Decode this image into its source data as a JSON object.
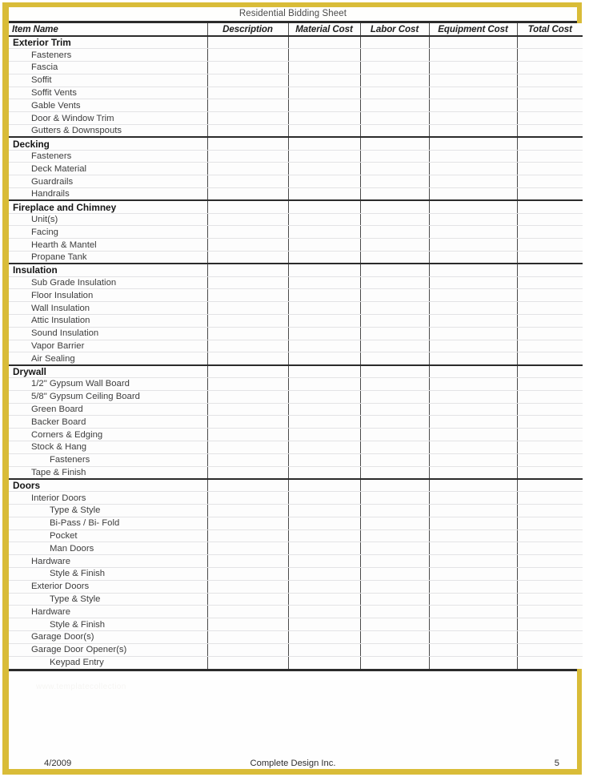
{
  "document": {
    "title": "Residential Bidding Sheet",
    "watermark": "www.templatecollection"
  },
  "colors": {
    "border_gold": "#d9bc38",
    "rule_dark": "#2b2b2b",
    "grid_light": "#e3e3e5",
    "text": "#3d3d3d"
  },
  "table": {
    "columns": [
      {
        "key": "item",
        "label": "Item Name",
        "align": "left"
      },
      {
        "key": "desc",
        "label": "Description",
        "align": "center"
      },
      {
        "key": "material",
        "label": "Material Cost",
        "align": "center"
      },
      {
        "key": "labor",
        "label": "Labor Cost",
        "align": "center"
      },
      {
        "key": "equipment",
        "label": "Equipment Cost",
        "align": "center"
      },
      {
        "key": "total",
        "label": "Total Cost",
        "align": "center"
      }
    ],
    "sections": [
      {
        "heading": "Exterior Trim",
        "rows": [
          {
            "label": "Fasteners",
            "level": 1
          },
          {
            "label": "Fascia",
            "level": 1
          },
          {
            "label": "Soffit",
            "level": 1
          },
          {
            "label": "Soffit Vents",
            "level": 1
          },
          {
            "label": "Gable Vents",
            "level": 1
          },
          {
            "label": "Door & Window Trim",
            "level": 1
          },
          {
            "label": "Gutters & Downspouts",
            "level": 1
          }
        ]
      },
      {
        "heading": "Decking",
        "rows": [
          {
            "label": "Fasteners",
            "level": 1
          },
          {
            "label": "Deck Material",
            "level": 1
          },
          {
            "label": "Guardrails",
            "level": 1
          },
          {
            "label": "Handrails",
            "level": 1
          }
        ]
      },
      {
        "heading": "Fireplace and Chimney",
        "rows": [
          {
            "label": "Unit(s)",
            "level": 1
          },
          {
            "label": "Facing",
            "level": 1
          },
          {
            "label": "Hearth & Mantel",
            "level": 1
          },
          {
            "label": "Propane Tank",
            "level": 1
          }
        ]
      },
      {
        "heading": "Insulation",
        "rows": [
          {
            "label": "Sub Grade Insulation",
            "level": 1
          },
          {
            "label": "Floor Insulation",
            "level": 1
          },
          {
            "label": "Wall Insulation",
            "level": 1
          },
          {
            "label": "Attic Insulation",
            "level": 1
          },
          {
            "label": "Sound Insulation",
            "level": 1
          },
          {
            "label": "Vapor Barrier",
            "level": 1
          },
          {
            "label": "Air Sealing",
            "level": 1
          }
        ]
      },
      {
        "heading": "Drywall",
        "rows": [
          {
            "label": "1/2\" Gypsum Wall Board",
            "level": 1
          },
          {
            "label": "5/8\" Gypsum Ceiling Board",
            "level": 1
          },
          {
            "label": "Green Board",
            "level": 1
          },
          {
            "label": "Backer Board",
            "level": 1
          },
          {
            "label": "Corners & Edging",
            "level": 1
          },
          {
            "label": "Stock & Hang",
            "level": 1
          },
          {
            "label": "Fasteners",
            "level": 2
          },
          {
            "label": "Tape & Finish",
            "level": 1
          }
        ]
      },
      {
        "heading": "Doors",
        "rows": [
          {
            "label": "Interior Doors",
            "level": 1
          },
          {
            "label": "Type & Style",
            "level": 2
          },
          {
            "label": "Bi-Pass / Bi- Fold",
            "level": 2
          },
          {
            "label": "Pocket",
            "level": 2
          },
          {
            "label": "Man Doors",
            "level": 2
          },
          {
            "label": "Hardware",
            "level": 1
          },
          {
            "label": "Style & Finish",
            "level": 2
          },
          {
            "label": "Exterior Doors",
            "level": 1
          },
          {
            "label": "Type & Style",
            "level": 2
          },
          {
            "label": "Hardware",
            "level": 1
          },
          {
            "label": "Style & Finish",
            "level": 2
          },
          {
            "label": "Garage Door(s)",
            "level": 1
          },
          {
            "label": "Garage Door Opener(s)",
            "level": 1
          },
          {
            "label": "Keypad Entry",
            "level": 2
          }
        ]
      }
    ]
  },
  "footer": {
    "date": "4/2009",
    "company": "Complete Design Inc.",
    "page_number": "5"
  }
}
